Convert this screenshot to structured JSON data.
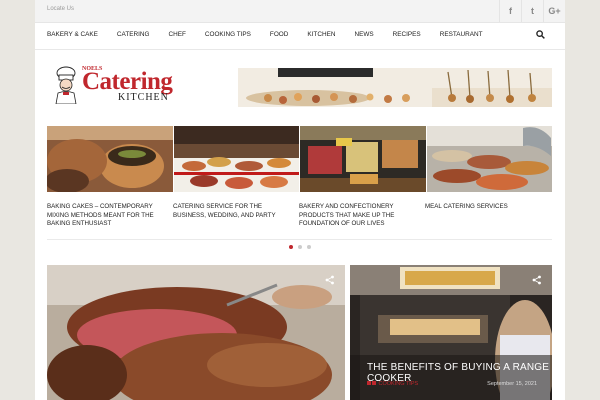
{
  "topbar": {
    "locate_label": "Locate Us"
  },
  "social": {
    "facebook": "f",
    "twitter": "t",
    "googleplus": "G+"
  },
  "nav": {
    "items": [
      "BAKERY & CAKE",
      "CATERING",
      "CHEF",
      "COOKING TIPS",
      "FOOD",
      "KITCHEN",
      "NEWS",
      "RECIPES",
      "RESTAURANT"
    ]
  },
  "logo": {
    "small": "NOELS",
    "big": "Catering",
    "sub": "KITCHEN"
  },
  "slides": [
    {
      "title": "BAKING CAKES – CONTEMPORARY MIXING METHODS MEANT FOR THE BAKING ENTHUSIAST"
    },
    {
      "title": "CATERING SERVICE FOR THE BUSINESS, WEDDING, AND PARTY"
    },
    {
      "title": "BAKERY AND CONFECTIONERY PRODUCTS THAT MAKE UP THE FOUNDATION OF OUR LIVES"
    },
    {
      "title": "MEAL CATERING SERVICES"
    }
  ],
  "slider": {
    "active_index": 0,
    "count": 3
  },
  "featured": {
    "second": {
      "title": "THE BENEFITS OF BUYING A RANGE COOKER",
      "category": "COOKING TIPS",
      "date": "September 15, 2021"
    }
  },
  "colors": {
    "accent": "#c0272d"
  }
}
